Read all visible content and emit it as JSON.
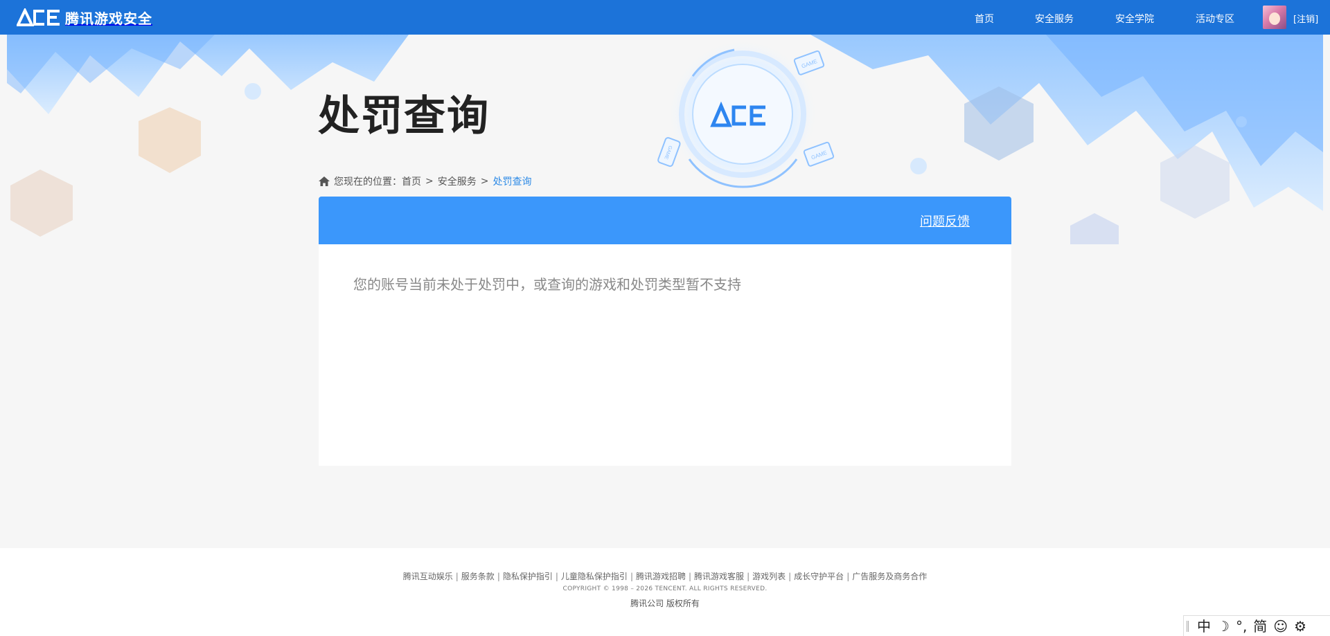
{
  "header": {
    "logo_mark": "ACE",
    "logo_text": "腾讯游戏安全",
    "nav": [
      {
        "label": "首页"
      },
      {
        "label": "安全服务"
      },
      {
        "label": "安全学院"
      },
      {
        "label": "活动专区"
      }
    ],
    "logout": "[注销]",
    "colors": {
      "bar": "#1c73d9"
    }
  },
  "hero": {
    "title": "处罚查询",
    "emblem_mark": "ACE",
    "badges": [
      "GAME",
      "GAME",
      "GAME"
    ]
  },
  "breadcrumb": {
    "prefix": "您现在的位置：",
    "items": [
      "首页",
      "安全服务",
      "处罚查询"
    ],
    "separator": ">"
  },
  "panel": {
    "feedback": "问题反馈",
    "message": "您的账号当前未处于处罚中，或查询的游戏和处罚类型暂不支持",
    "colors": {
      "header": "#3b97fb"
    }
  },
  "footer": {
    "links": [
      "腾讯互动娱乐",
      "服务条款",
      "隐私保护指引",
      "儿童隐私保护指引",
      "腾讯游戏招聘",
      "腾讯游戏客服",
      "游戏列表",
      "成长守护平台",
      "广告服务及商务合作"
    ],
    "copyright": "COPYRIGHT © 1998 – 2026 TENCENT. ALL RIGHTS RESERVED.",
    "company": "腾讯公司 版权所有"
  },
  "ime_toolbar": {
    "items": [
      "中",
      "☽",
      "°,",
      "简",
      "☺",
      "⚙"
    ]
  }
}
